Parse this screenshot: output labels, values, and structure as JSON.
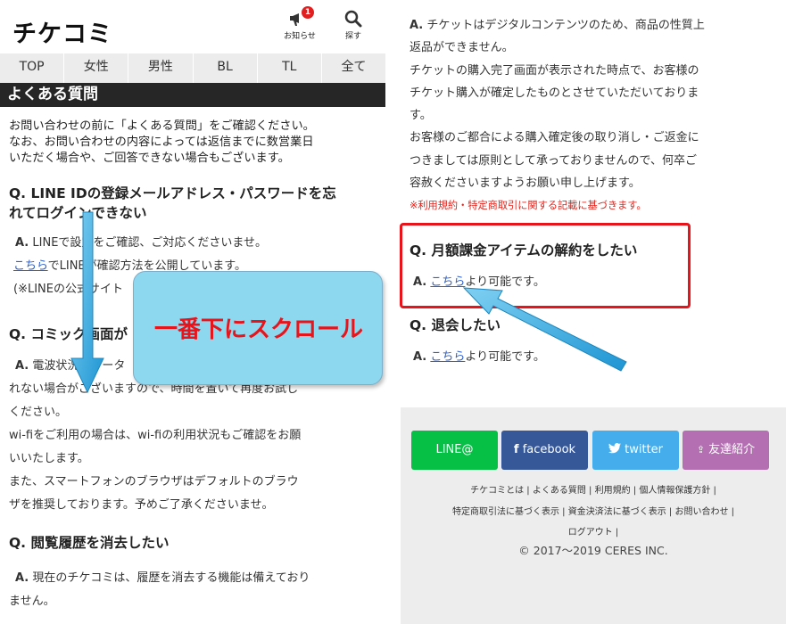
{
  "header": {
    "logo": "チケコミ",
    "news_label": "お知らせ",
    "news_badge": "1",
    "search_label": "探す"
  },
  "nav": {
    "tabs": [
      "TOP",
      "女性",
      "男性",
      "BL",
      "TL",
      "全て"
    ]
  },
  "page_title": "よくある質問",
  "intro": {
    "line1": "お問い合わせの前に「よくある質問」をご確認ください。",
    "line2": "なお、お問い合わせの内容によっては返信までに数営業日",
    "line3": "いただく場合や、ご回答できない場合もございます。"
  },
  "faq_left": {
    "q1_line1": "Q. LINE IDの登録メールアドレス・パスワードを忘",
    "q1_line2": "れてログインできない",
    "a1_prefix": "A.",
    "a1_line1": "LINEで設定をご確認、ご対応くださいませ。",
    "a1_link": "こちら",
    "a1_line2": "でLINEが確認方法を公開しています。",
    "a1_line3": "(※LINEの公式サイト",
    "q2": "Q. コミック画面が",
    "a2_prefix": "A.",
    "a2_line1": "電波状況でデータ",
    "a2_line2": "れない場合がございますので、時間を置いて再度お試し",
    "a2_line3": "ください。",
    "a2_line4": "wi-fiをご利用の場合は、wi-fiの利用状況もご確認をお願",
    "a2_line5": "いいたします。",
    "a2_line6": "また、スマートフォンのブラウザはデフォルトのブラウ",
    "a2_line7": "ザを推奨しております。予めご了承くださいませ。",
    "q3": "Q. 閲覧履歴を消去したい",
    "a3_prefix": "A.",
    "a3_line1": "現在のチケコミは、履歴を消去する機能は備えており",
    "a3_line2": "ません。"
  },
  "faq_right": {
    "r_prefix": "A.",
    "r_line1": "チケットはデジタルコンテンツのため、商品の性質上",
    "r_line2": "返品ができません。",
    "r_line3": "チケットの購入完了画面が表示された時点で、お客様の",
    "r_line4": "チケット購入が確定したものとさせていただいておりま",
    "r_line5": "す。",
    "r_line6": "お客様のご都合による購入確定後の取り消し・ご返金に",
    "r_line7": "つきましては原則として承っておりませんので、何卒ご",
    "r_line8": "容赦くださいますようお願い申し上げます。",
    "note": "※利用規約・特定商取引に関する記載に基づきます。",
    "q_cancel": "Q. 月額課金アイテムの解約をしたい",
    "a_cancel_prefix": "A.",
    "a_cancel_link": "こちら",
    "a_cancel_rest": "より可能です。",
    "q_withdraw": "Q. 退会したい",
    "a_withdraw_prefix": "A.",
    "a_withdraw_link": "こちら",
    "a_withdraw_rest": "より可能です。"
  },
  "footer": {
    "share_line": "LINE@",
    "share_facebook": "facebook",
    "share_twitter": "twitter",
    "share_friend": "友達紹介",
    "link_about": "チケコミとは",
    "link_faq": "よくある質問",
    "link_terms": "利用規約",
    "link_privacy": "個人情報保護方針",
    "link_tokusho": "特定商取引法に基づく表示",
    "link_payment": "資金決済法に基づく表示",
    "link_contact": "お問い合わせ",
    "link_logout": "ログアウト",
    "separator": "|",
    "copyright": "© 2017〜2019 CERES INC."
  },
  "overlay": {
    "callout_text": "一番下にスクロール"
  },
  "colors": {
    "accent_red": "#e8141b",
    "link_blue": "#2d5ec9",
    "line_green": "#06c046",
    "facebook_blue": "#365899",
    "twitter_blue": "#46aded",
    "friend_purple": "#b36fb1",
    "callout_bg": "#8ed8ef",
    "arrow_blue": "#2aa6e0"
  }
}
